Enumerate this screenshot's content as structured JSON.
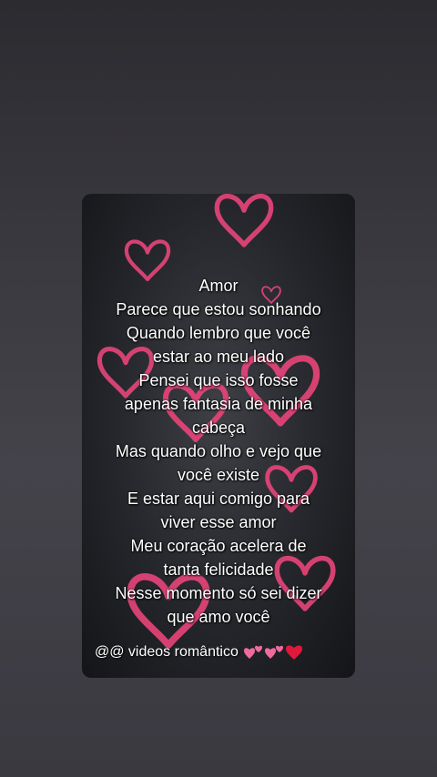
{
  "poem_lines": [
    "Amor",
    "Parece que estou sonhando",
    "Quando lembro que você",
    "estar ao meu lado",
    "Pensei que isso fosse",
    "apenas fantasia de minha",
    "cabeça",
    "Mas quando olho e vejo que",
    "você existe",
    "E estar aqui comigo para",
    "viver esse amor",
    "Meu coração acelera de",
    "tanta felicidade",
    "Nesse momento só sei dizer",
    "que amo você"
  ],
  "watermark": {
    "text": "@@ videos  romântico"
  },
  "colors": {
    "heart_pink": "#e8457a",
    "heart_red": "#e0183a",
    "text": "#ffffff"
  },
  "icons": [
    "two-hearts-icon",
    "two-hearts-icon",
    "red-heart-icon"
  ]
}
